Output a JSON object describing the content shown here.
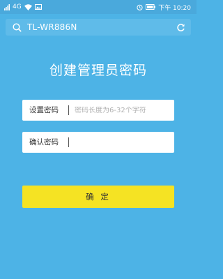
{
  "statusbar": {
    "network": "4G",
    "time": "下午 10:20"
  },
  "address_bar": {
    "url": "TL-WR886N",
    "search_icon": "search-icon",
    "refresh_icon": "refresh-icon"
  },
  "page": {
    "title": "创建管理员密码",
    "password_label": "设置密码",
    "password_placeholder": "密码长度为6-32个字符",
    "confirm_label": "确认密码",
    "confirm_value": "",
    "confirm_button": "确 定"
  },
  "colors": {
    "background": "#4db3e6",
    "button": "#f5e323"
  }
}
